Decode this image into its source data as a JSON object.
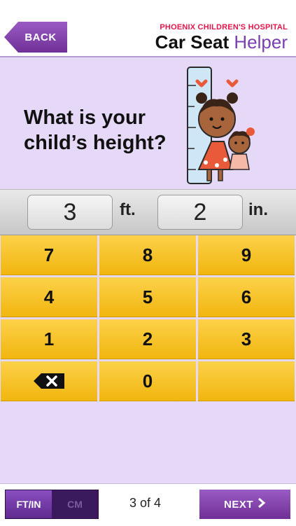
{
  "header": {
    "back_label": "BACK",
    "brand_top": "PHOENIX CHILDREN'S HOSPITAL",
    "brand_main_bold": "Car Seat",
    "brand_main_light": "Helper"
  },
  "question": {
    "line1": "What is your",
    "line2": "child’s height?"
  },
  "entry": {
    "feet_value": "3",
    "feet_unit": "ft.",
    "inches_value": "2",
    "inches_unit": "in."
  },
  "keypad": {
    "keys": [
      "7",
      "8",
      "9",
      "4",
      "5",
      "6",
      "1",
      "2",
      "3",
      "delete",
      "0",
      ""
    ]
  },
  "footer": {
    "unit_option_1": "FT/IN",
    "unit_option_2": "CM",
    "page_indicator": "3 of 4",
    "next_label": "NEXT"
  },
  "colors": {
    "purple": "#7a3fb0",
    "lavender": "#e6d8f7",
    "key_yellow": "#f8c52c",
    "brand_red": "#e2164b"
  }
}
